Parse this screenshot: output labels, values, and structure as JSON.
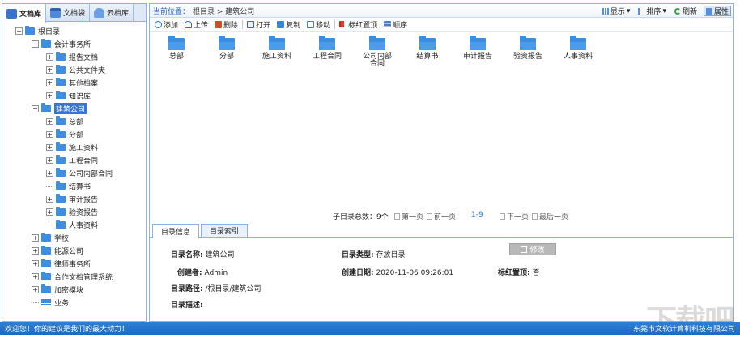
{
  "tabs": [
    {
      "label": "文档库",
      "icon": "library-icon"
    },
    {
      "label": "文档袋",
      "icon": "bag-icon"
    },
    {
      "label": "云档库",
      "icon": "cloud-icon"
    }
  ],
  "tree": {
    "root": "根目录",
    "accounting": "会计事务所",
    "accounting_children": [
      "报告文档",
      "公共文件夹",
      "其他档案",
      "知识库"
    ],
    "construction": "建筑公司",
    "construction_children": [
      "总部",
      "分部",
      "施工资料",
      "工程合同",
      "公司内部合同",
      "结算书",
      "审计报告",
      "验资报告",
      "人事资料"
    ],
    "others": [
      "学校",
      "能源公司",
      "律师事务所",
      "合作文档管理系统",
      "加密模块"
    ],
    "business": "业务"
  },
  "crumb": {
    "label": "当前位置：",
    "path": "根目录 > 建筑公司"
  },
  "viewtools": {
    "display": "显示",
    "sort": "排序",
    "refresh": "刷新",
    "properties": "属性"
  },
  "toolbar": {
    "add": "添加",
    "upload": "上传",
    "delete": "删除",
    "open": "打开",
    "copy": "复制",
    "move": "移动",
    "flag": "标红置顶",
    "order": "顺序"
  },
  "folders": [
    "总部",
    "分部",
    "施工资料",
    "工程合同",
    "公司内部合同",
    "结算书",
    "审计报告",
    "验资报告",
    "人事资料"
  ],
  "pager": {
    "total": "子目录总数：9个",
    "first": "第一页",
    "prev": "前一页",
    "range": "1-9",
    "next": "下一页",
    "last": "最后一页"
  },
  "lower_tabs": [
    "目录信息",
    "目录索引"
  ],
  "info": {
    "name_label": "目录名称:",
    "name": "建筑公司",
    "type_label": "目录类型:",
    "type": "存放目录",
    "creator_label": "创建者:",
    "creator": "Admin",
    "date_label": "创建日期:",
    "date": "2020-11-06 09:26:01",
    "flag_label": "标红置顶:",
    "flag": "否",
    "path_label": "目录路径:",
    "path": "/根目录/建筑公司",
    "desc_label": "目录描述:",
    "edit": "修改"
  },
  "status": {
    "left": "欢迎您！你的建议是我们的最大动力！",
    "right": "东莞市文软计算机科技有限公司"
  },
  "watermark": "下载吧"
}
